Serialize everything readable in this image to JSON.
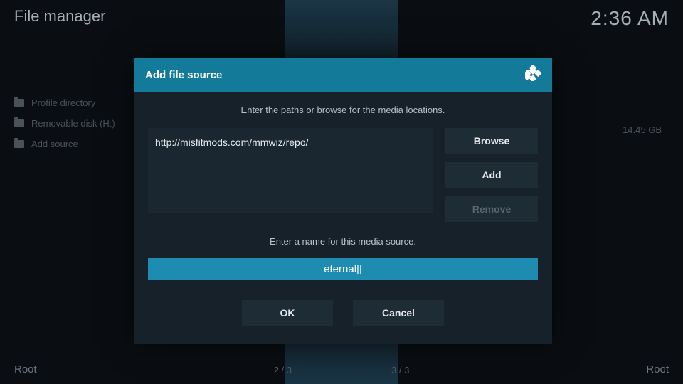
{
  "header": {
    "title": "File manager",
    "clock": "2:36 AM"
  },
  "sidebar": {
    "items": [
      {
        "label": "Profile directory"
      },
      {
        "label": "Removable disk (H:)"
      },
      {
        "label": "Add source"
      }
    ]
  },
  "disk_size": "14.45 GB",
  "footer": {
    "left": "Root",
    "right": "Root",
    "center_left": "2 / 3",
    "center_right": "3 / 3"
  },
  "dialog": {
    "title": "Add file source",
    "instruction": "Enter the paths or browse for the media locations.",
    "path_value": "http://misfitmods.com/mmwiz/repo/",
    "browse_label": "Browse",
    "add_label": "Add",
    "remove_label": "Remove",
    "name_instruction": "Enter a name for this media source.",
    "name_value": "eternal",
    "ok_label": "OK",
    "cancel_label": "Cancel"
  }
}
